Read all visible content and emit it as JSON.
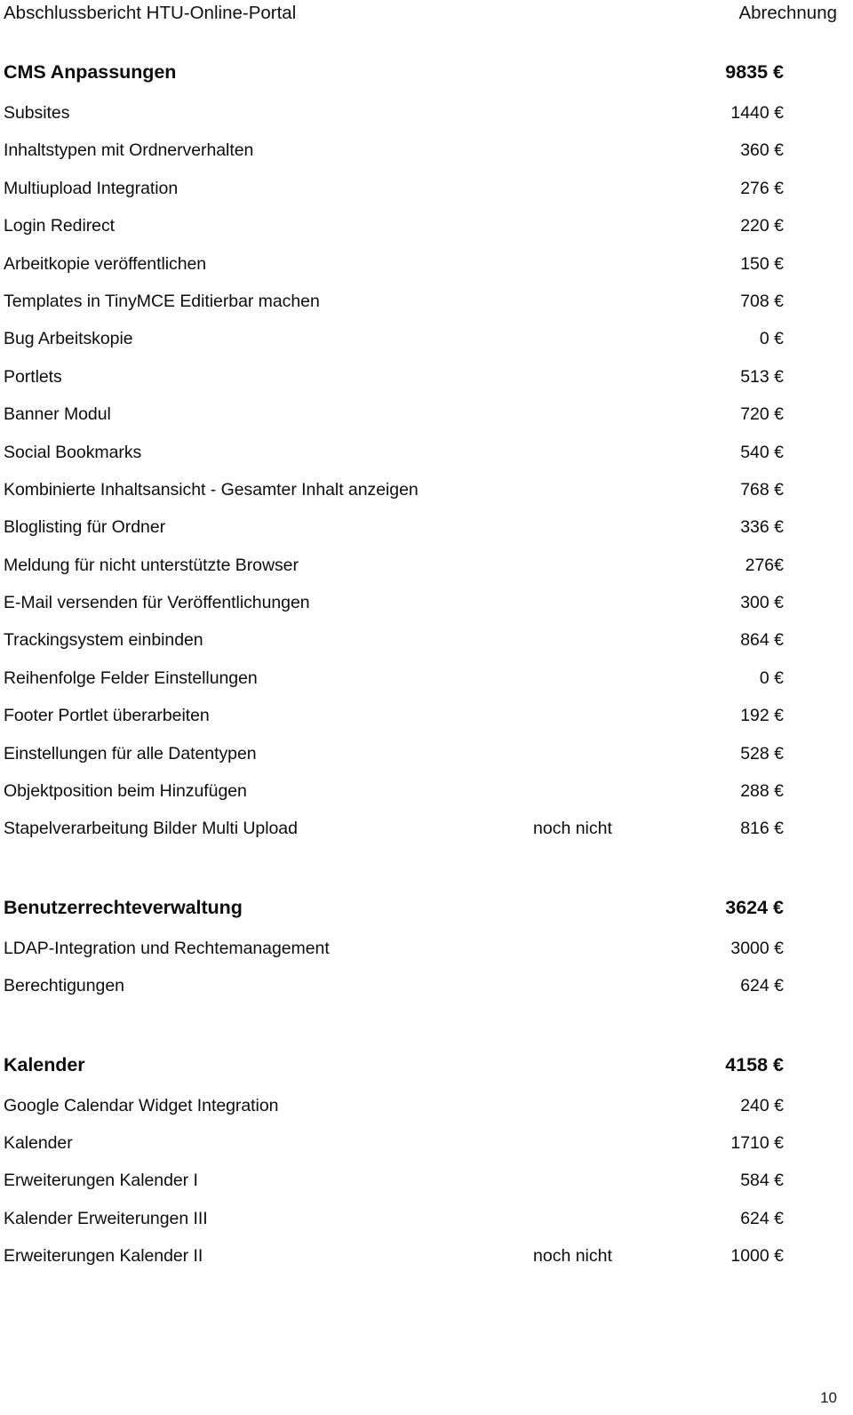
{
  "header": {
    "left": "Abschlussbericht HTU-Online-Portal",
    "right": "Abrechnung"
  },
  "footer": {
    "page_number": "10"
  },
  "currency": "€",
  "sections": [
    {
      "title": "CMS Anpassungen",
      "total": "9835 €",
      "rows": [
        {
          "label": "Subsites",
          "note": "",
          "amount": "1440 €"
        },
        {
          "label": "Inhaltstypen mit Ordnerverhalten",
          "note": "",
          "amount": "360 €"
        },
        {
          "label": "Multiupload Integration",
          "note": "",
          "amount": "276 €"
        },
        {
          "label": "Login Redirect",
          "note": "",
          "amount": "220 €"
        },
        {
          "label": "Arbeitkopie veröffentlichen",
          "note": "",
          "amount": "150 €"
        },
        {
          "label": "Templates in TinyMCE Editierbar machen",
          "note": "",
          "amount": "708 €"
        },
        {
          "label": "Bug Arbeitskopie",
          "note": "",
          "amount": "0 €"
        },
        {
          "label": "Portlets",
          "note": "",
          "amount": "513 €"
        },
        {
          "label": "Banner Modul",
          "note": "",
          "amount": "720 €"
        },
        {
          "label": "Social Bookmarks",
          "note": "",
          "amount": "540 €"
        },
        {
          "label": "Kombinierte Inhaltsansicht - Gesamter Inhalt anzeigen",
          "note": "",
          "amount": "768 €"
        },
        {
          "label": "Bloglisting für Ordner",
          "note": "",
          "amount": "336 €"
        },
        {
          "label": "Meldung für nicht unterstützte Browser",
          "note": "",
          "amount": "276€"
        },
        {
          "label": "E-Mail versenden für Veröffentlichungen",
          "note": "",
          "amount": "300 €"
        },
        {
          "label": "Trackingsystem einbinden",
          "note": "",
          "amount": "864 €"
        },
        {
          "label": "Reihenfolge Felder Einstellungen",
          "note": "",
          "amount": "0 €"
        },
        {
          "label": "Footer Portlet überarbeiten",
          "note": "",
          "amount": "192 €"
        },
        {
          "label": "Einstellungen für alle Datentypen",
          "note": "",
          "amount": "528 €"
        },
        {
          "label": "Objektposition beim Hinzufügen",
          "note": "",
          "amount": "288 €"
        },
        {
          "label": "Stapelverarbeitung Bilder Multi Upload",
          "note": "noch nicht",
          "amount": "816 €"
        }
      ]
    },
    {
      "title": "Benutzerrechteverwaltung",
      "total": "3624 €",
      "rows": [
        {
          "label": "LDAP-Integration und Rechtemanagement",
          "note": "",
          "amount": "3000 €"
        },
        {
          "label": "Berechtigungen",
          "note": "",
          "amount": "624 €"
        }
      ]
    },
    {
      "title": "Kalender",
      "total": "4158 €",
      "rows": [
        {
          "label": "Google Calendar Widget Integration",
          "note": "",
          "amount": "240 €"
        },
        {
          "label": "Kalender",
          "note": "",
          "amount": "1710 €"
        },
        {
          "label": "Erweiterungen Kalender I",
          "note": "",
          "amount": "584 €"
        },
        {
          "label": "Kalender Erweiterungen III",
          "note": "",
          "amount": "624 €"
        },
        {
          "label": "Erweiterungen Kalender II",
          "note": "noch nicht",
          "amount": "1000 €"
        }
      ]
    }
  ]
}
